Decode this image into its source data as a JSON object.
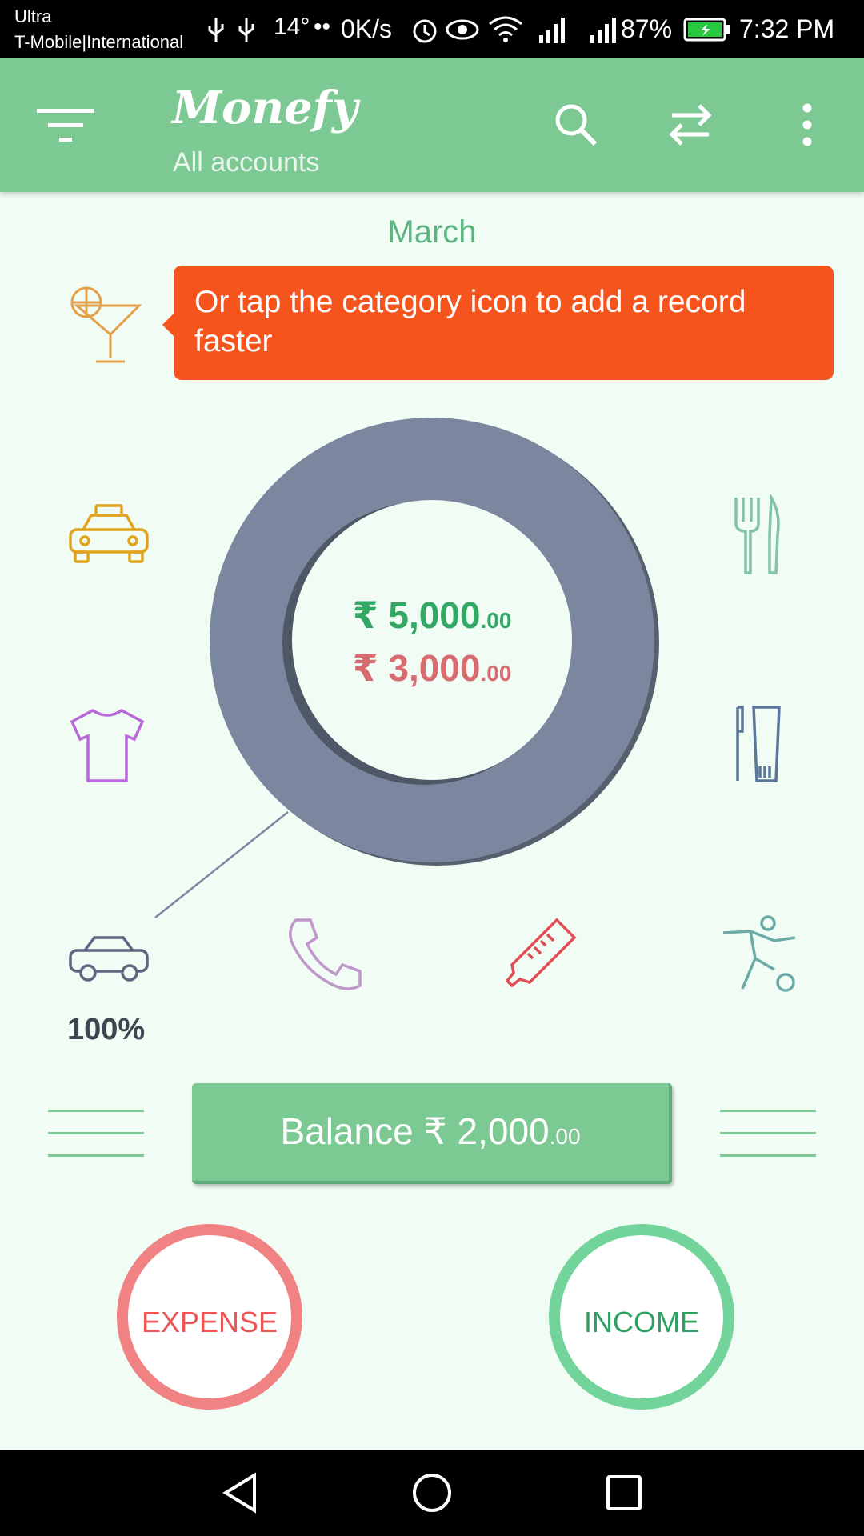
{
  "status_bar": {
    "carrier_line1": "Ultra",
    "carrier_line2": "T-Mobile|International",
    "temperature": "14°",
    "dots": "••",
    "network_speed": "0K/s",
    "battery_percent": "87%",
    "time": "7:32 PM"
  },
  "app_bar": {
    "logo": "Monefy",
    "subtitle": "All accounts",
    "icons": [
      "filter-icon",
      "search-icon",
      "transfer-icon",
      "more-icon"
    ]
  },
  "month": "March",
  "tooltip": {
    "text": "Or tap the category icon to add a record faster"
  },
  "categories": [
    "cocktail",
    "taxi",
    "clothes",
    "car",
    "phone",
    "thermometer",
    "sports",
    "toiletries",
    "food"
  ],
  "chart_data": {
    "type": "pie",
    "values": [
      100
    ],
    "colors": [
      "#7b879e"
    ]
  },
  "summary": {
    "income_main": "₹ 5,000",
    "income_dec": ".00",
    "expense_main": "₹ 3,000",
    "expense_dec": ".00",
    "percent_label": "100%"
  },
  "balance": {
    "label_main": "Balance ₹ 2,000",
    "label_dec": ".00"
  },
  "buttons": {
    "expense": "EXPENSE",
    "income": "INCOME"
  },
  "colors": {
    "primary": "#7dc994",
    "tooltip": "#f5541d",
    "expense": "#f18283",
    "income": "#72d49a",
    "donut": "#7b879e",
    "background": "#f0fcf4"
  }
}
